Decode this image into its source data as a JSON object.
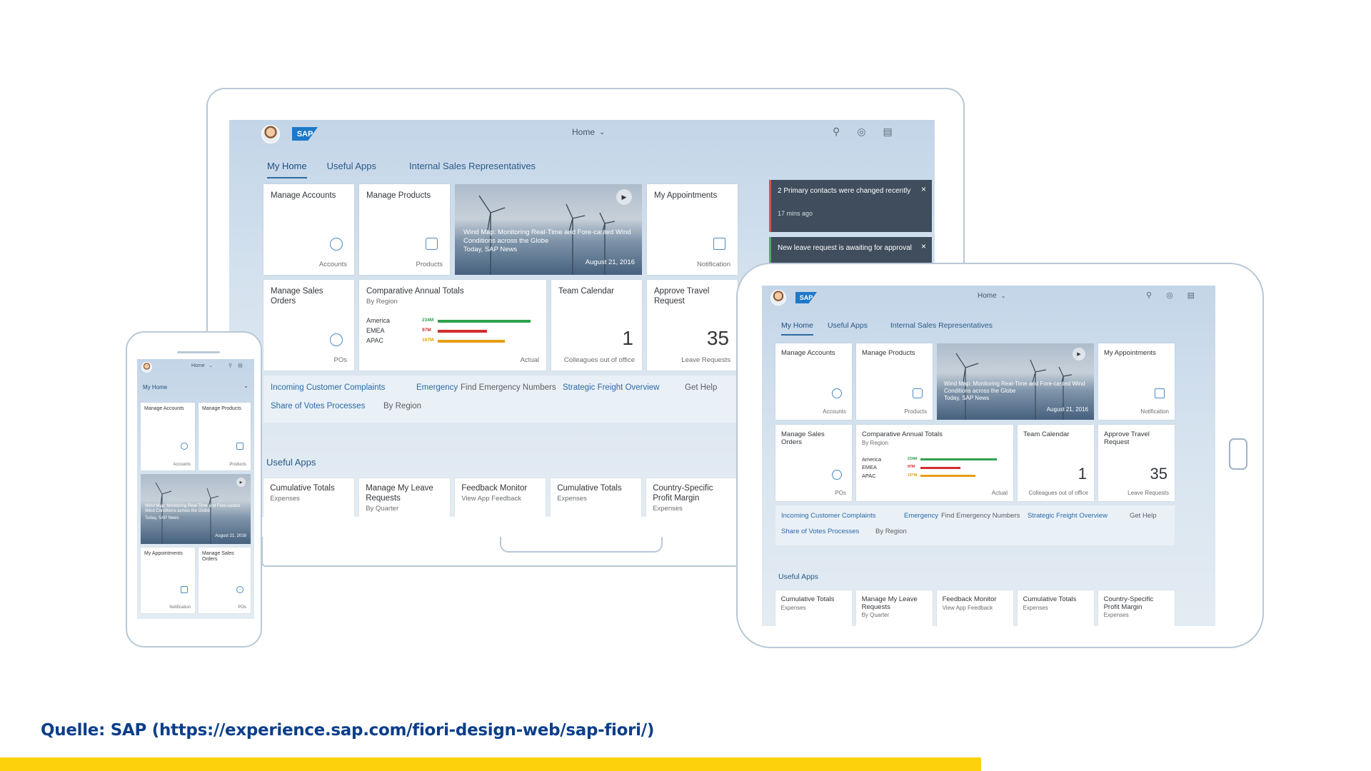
{
  "caption": "Quelle:  SAP (https://experience.sap.com/fiori-design-web/sap-fiori/)",
  "shell": {
    "logo": "SAP",
    "home_label": "Home",
    "home_chevron": "chevron-down-icon",
    "icons": [
      "search-icon",
      "notifications-icon",
      "menu-icon"
    ]
  },
  "tabs": [
    "My Home",
    "Useful Apps",
    "Internal Sales Representatives"
  ],
  "tiles": {
    "manage_accounts": {
      "title": "Manage Accounts",
      "footer": "Accounts",
      "icon": "accounts-icon"
    },
    "manage_products": {
      "title": "Manage Products",
      "footer": "Products",
      "icon": "products-icon"
    },
    "news": {
      "text": "Wind Map: Monitoring Real-Time and Fore-casted Wind Conditions across the Globe",
      "source": "Today, SAP News",
      "date": "August 21, 2016",
      "icon": "play-icon"
    },
    "my_appointments": {
      "title": "My Appointments",
      "footer": "Notification",
      "icon": "calendar-icon"
    },
    "manage_sales_orders": {
      "title": "Manage Sales Orders",
      "footer": "POs",
      "icon": "sales-orders-icon"
    },
    "comparative": {
      "title": "Comparative Annual Totals",
      "subtitle": "By Region",
      "footer": "Actual",
      "bars": [
        {
          "label": "America",
          "value": "234M",
          "fraction": 1.0,
          "color": "#2fa14e"
        },
        {
          "label": "EMEA",
          "value": "97M",
          "fraction": 0.53,
          "color": "#d42d2d"
        },
        {
          "label": "APAC",
          "value": "197M",
          "fraction": 0.72,
          "color": "#e89c15"
        }
      ]
    },
    "team_calendar": {
      "title": "Team Calendar",
      "number": "1",
      "footer": "Colleagues out of office"
    },
    "approve_travel": {
      "title": "Approve Travel Request",
      "number": "35",
      "footer": "Leave Requests"
    }
  },
  "links": {
    "row1": [
      {
        "link": "Incoming Customer Complaints",
        "sub": ""
      },
      {
        "link": "Emergency",
        "sub": "Find Emergency Numbers"
      },
      {
        "link": "Strategic Freight Overview",
        "sub": "Get Help"
      }
    ],
    "row2": [
      {
        "link": "Share of Votes Processes",
        "sub": "By Region"
      }
    ]
  },
  "useful_apps": {
    "heading": "Useful Apps",
    "apps": [
      {
        "title": "Cumulative Totals",
        "subtitle": "Expenses"
      },
      {
        "title": "Manage My Leave Requests",
        "subtitle": "By Quarter"
      },
      {
        "title": "Feedback Monitor",
        "subtitle": "View App Feedback"
      },
      {
        "title": "Cumulative Totals",
        "subtitle": "Expenses"
      },
      {
        "title": "Country-Specific Profit Margin",
        "subtitle": "Expenses"
      }
    ]
  },
  "notifications": [
    {
      "text": "2 Primary contacts were changed recently",
      "time": "17 mins ago",
      "close": "close-icon"
    },
    {
      "text": "New leave request is awaiting for approval",
      "close": "close-icon"
    }
  ],
  "phone": {
    "home_label": "Home",
    "tab": "My Home",
    "tiles": [
      {
        "title": "Manage Accounts",
        "footer": "Accounts"
      },
      {
        "title": "Manage Products",
        "footer": "Products"
      },
      {
        "title": "My Appointments",
        "footer": "Notification"
      },
      {
        "title": "Manage Sales Orders",
        "footer": "POs"
      }
    ],
    "news_text": "Wind Map: Monitoring Real-Time and Fore-casted Wind Conditions across the Globe",
    "news_source": "Today, SAP News",
    "news_date": "August 21, 2016"
  }
}
